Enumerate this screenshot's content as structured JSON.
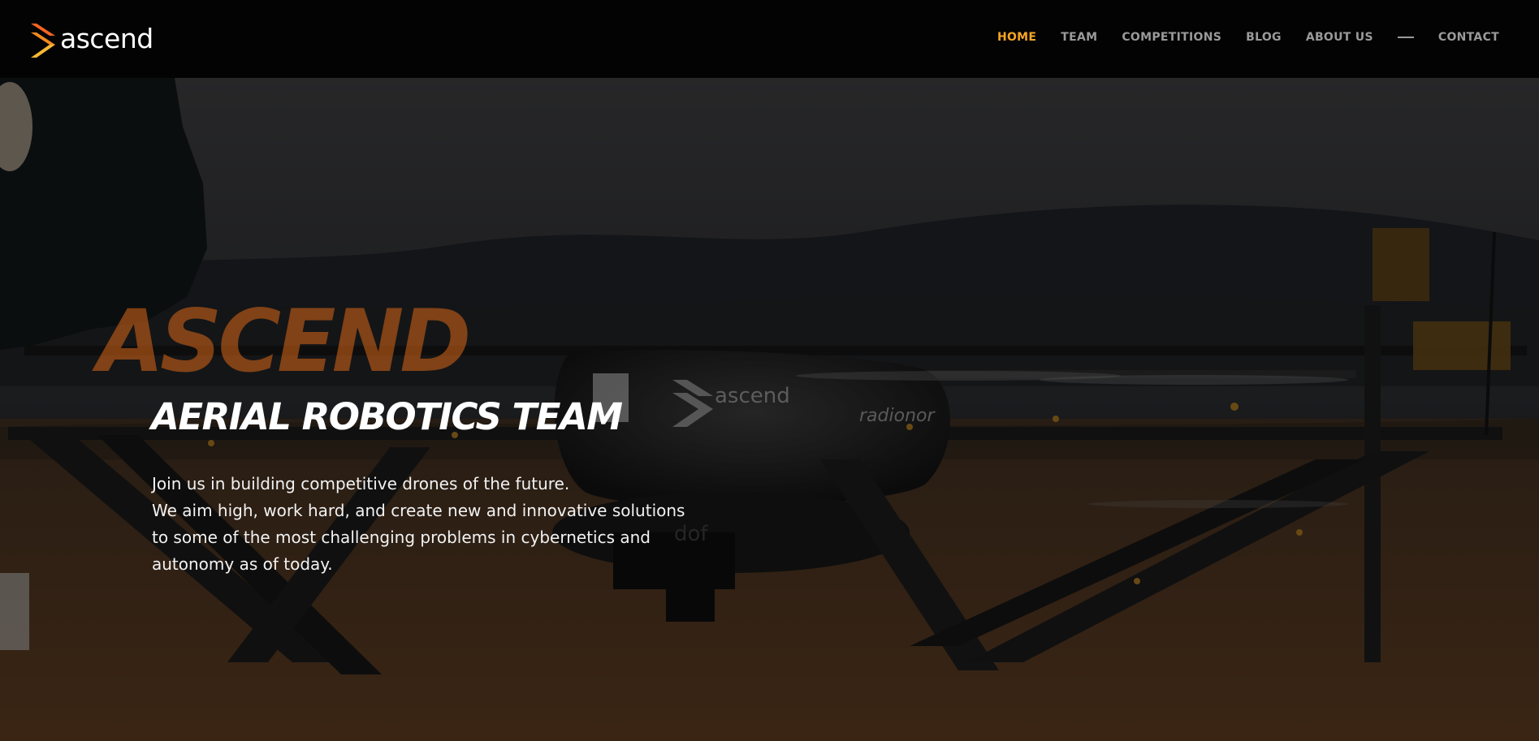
{
  "brand": {
    "name": "ascend",
    "accent_color": "#f5a623",
    "logo_colors": [
      "#f28a1e",
      "#f7b733",
      "#f26522"
    ]
  },
  "nav": {
    "items": [
      {
        "label": "HOME",
        "active": true
      },
      {
        "label": "TEAM",
        "active": false
      },
      {
        "label": "COMPETITIONS",
        "active": false
      },
      {
        "label": "BLOG",
        "active": false
      },
      {
        "label": "ABOUT US",
        "active": false
      }
    ],
    "separator_icon": "dash-separator",
    "contact_label": "CONTACT"
  },
  "hero": {
    "background": "drone-photo",
    "big_word": "ASCEND",
    "title": "AERIAL ROBOTICS TEAM",
    "lines": [
      "Join us in building competitive drones of the future.",
      "We aim high, work hard, and create new and innovative solutions",
      "to some of the most challenging problems in cybernetics and",
      "autonomy as of today."
    ],
    "drone_decals": [
      "ascend",
      "radionor",
      "dof"
    ]
  }
}
